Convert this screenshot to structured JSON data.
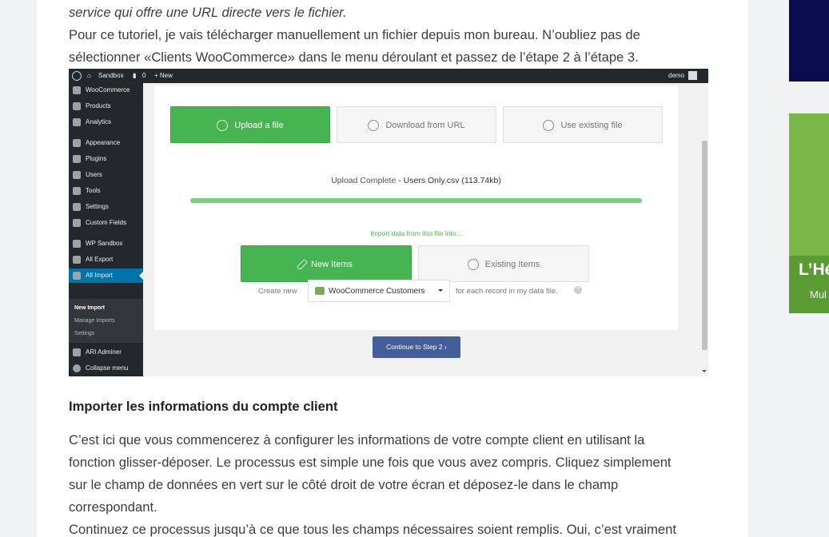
{
  "article": {
    "line_top_italic": "service qui offre une URL directe vers le fichier.",
    "para1_line1": "Pour ce tutoriel, je vais télécharger manuellement un fichier depuis mon bureau. N’oubliez pas de",
    "para1_line2": "sélectionner «Clients WooCommerce» dans le menu déroulant et passez de l’étape 2 à l’étape 3.",
    "heading": "Importer les informations du compte client",
    "para2_line1": "C’est ici que vous commencerez à configurer les informations de votre compte client en utilisant la",
    "para2_line2": "fonction glisser-déposer. Le processus est simple une fois que vous avez compris. Cliquez simplement",
    "para2_line3": "sur le champ de données en vert sur le côté droit de votre écran et déposez-le dans le champ",
    "para2_line4": "correspondant.",
    "para3_line1": "Continuez ce processus jusqu’à ce que tous les champs nécessaires soient remplis. Oui, c’est vraiment"
  },
  "screenshot": {
    "adminbar": {
      "site": "Sandbox",
      "comments": "0",
      "new": "+ New",
      "user": "demo"
    },
    "sidebar": [
      {
        "label": "WooCommerce"
      },
      {
        "label": "Products"
      },
      {
        "label": "Analytics"
      },
      {
        "label": "Appearance"
      },
      {
        "label": "Plugins"
      },
      {
        "label": "Users"
      },
      {
        "label": "Tools"
      },
      {
        "label": "Settings"
      },
      {
        "label": "Custom Fields"
      },
      {
        "label": "WP Sandbox"
      },
      {
        "label": "All Export"
      },
      {
        "label": "All Import"
      },
      {
        "label": "ARI Adminer"
      },
      {
        "label": "Collapse menu"
      }
    ],
    "submenu": [
      "New Import",
      "Manage Imports",
      "Settings"
    ],
    "upload_buttons": [
      "Upload a file",
      "Download from URL",
      "Use existing file"
    ],
    "upload_status_prefix": "Upload Complete",
    "upload_status_file": " - Users Only.csv (113.74kb)",
    "progress_percent": 100,
    "import_into": "Import data from this file into...",
    "items_buttons": [
      "New Items",
      "Existing Items"
    ],
    "create_new_label": "Create new",
    "select_value": "WooCommerce Customers",
    "for_each_label": "for each record in my data file.",
    "continue_label": "Continue to Step 2"
  },
  "ads": {
    "ad2_title": "L’Hé",
    "ad2_sub": "Mul"
  },
  "colors": {
    "green": "#46b450",
    "blue_button": "#425f9c",
    "admin_dark": "#23282d",
    "admin_active": "#0073aa"
  }
}
